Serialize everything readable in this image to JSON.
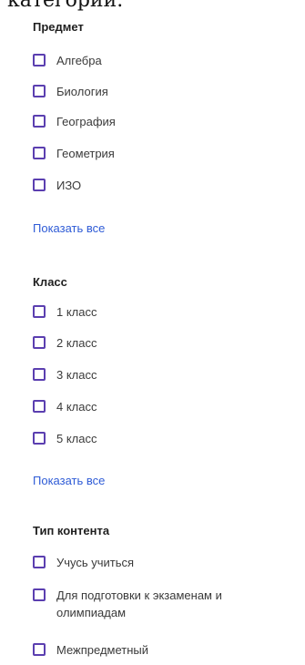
{
  "header_fragment": "категории.",
  "sections": [
    {
      "title": "Предмет",
      "options": [
        "Алгебра",
        "Биология",
        "География",
        "Геометрия",
        "ИЗО"
      ],
      "show_all": "Показать все"
    },
    {
      "title": "Класс",
      "options": [
        "1 класс",
        "2 класс",
        "3 класс",
        "4 класс",
        "5 класс"
      ],
      "show_all": "Показать все"
    },
    {
      "title": "Тип контента",
      "options": [
        "Учусь учиться",
        "Для подготовки к экзаменам и олимпиадам",
        "Межпредметный"
      ]
    }
  ],
  "colors": {
    "checkbox_border": "#5b3fb0",
    "link": "#2e5bd6"
  }
}
